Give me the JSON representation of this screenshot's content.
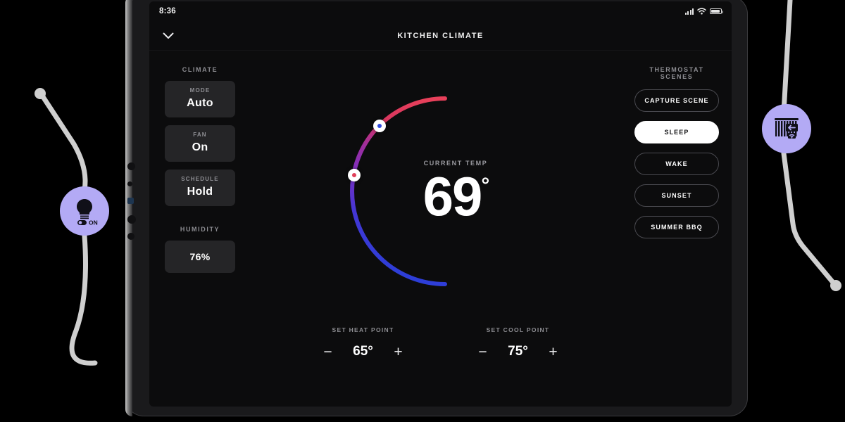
{
  "status_bar": {
    "time": "8:36",
    "signal_icon": "cellular-signal-icon",
    "wifi_icon": "wifi-icon",
    "battery_icon": "battery-icon"
  },
  "header": {
    "back_icon": "chevron-down-icon",
    "title": "KITCHEN CLIMATE"
  },
  "climate": {
    "section_title": "CLIMATE",
    "cards": [
      {
        "label": "MODE",
        "value": "Auto"
      },
      {
        "label": "FAN",
        "value": "On"
      },
      {
        "label": "SCHEDULE",
        "value": "Hold"
      }
    ],
    "humidity_title": "HUMIDITY",
    "humidity_value": "76%"
  },
  "scenes": {
    "section_title": "THERMOSTAT SCENES",
    "items": [
      {
        "label": "CAPTURE SCENE",
        "active": false
      },
      {
        "label": "SLEEP",
        "active": true
      },
      {
        "label": "WAKE",
        "active": false
      },
      {
        "label": "SUNSET",
        "active": false
      },
      {
        "label": "SUMMER BBQ",
        "active": false
      }
    ]
  },
  "dial": {
    "current_label": "CURRENT TEMP",
    "current_value": "69",
    "degree_symbol": "°",
    "arc_top_color": "#e8405a",
    "arc_mid_color": "#8b2fb0",
    "arc_bottom_color": "#2a3fd8",
    "heat_handle_color": "#e0405a",
    "cool_handle_color": "#2f4ae0"
  },
  "setpoints": [
    {
      "label": "SET HEAT POINT",
      "value": "65°",
      "minus": "−",
      "plus": "+"
    },
    {
      "label": "SET COOL POINT",
      "value": "75°",
      "minus": "−",
      "plus": "+"
    }
  ],
  "devices": [
    {
      "name": "light",
      "icon": "lightbulb-icon",
      "state": "ON",
      "color": "#b3aaf5"
    },
    {
      "name": "shades",
      "icon": "window-shades-icon",
      "state": "",
      "color": "#b3aaf5"
    }
  ]
}
